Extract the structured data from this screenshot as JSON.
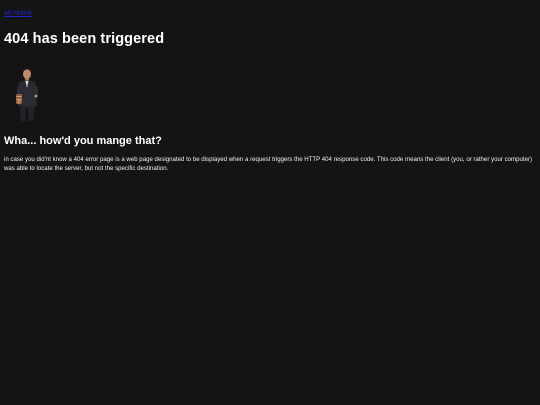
{
  "nav": {
    "home_link": "all Home"
  },
  "content": {
    "title": "404 has been triggered",
    "image": {
      "icon": "man-in-suit-photo"
    },
    "subtitle": "Wha... how'd you mange that?",
    "body": "in case you did'nt know a 404 error page is a web page designated to be displayed when a request triggers the HTTP 404 response code. This code means the client (you, or rather your computer) was able to locate the server, but not the specific destination."
  },
  "colors": {
    "background": "#141414",
    "text": "#ffffff",
    "link": "#2323c8"
  }
}
